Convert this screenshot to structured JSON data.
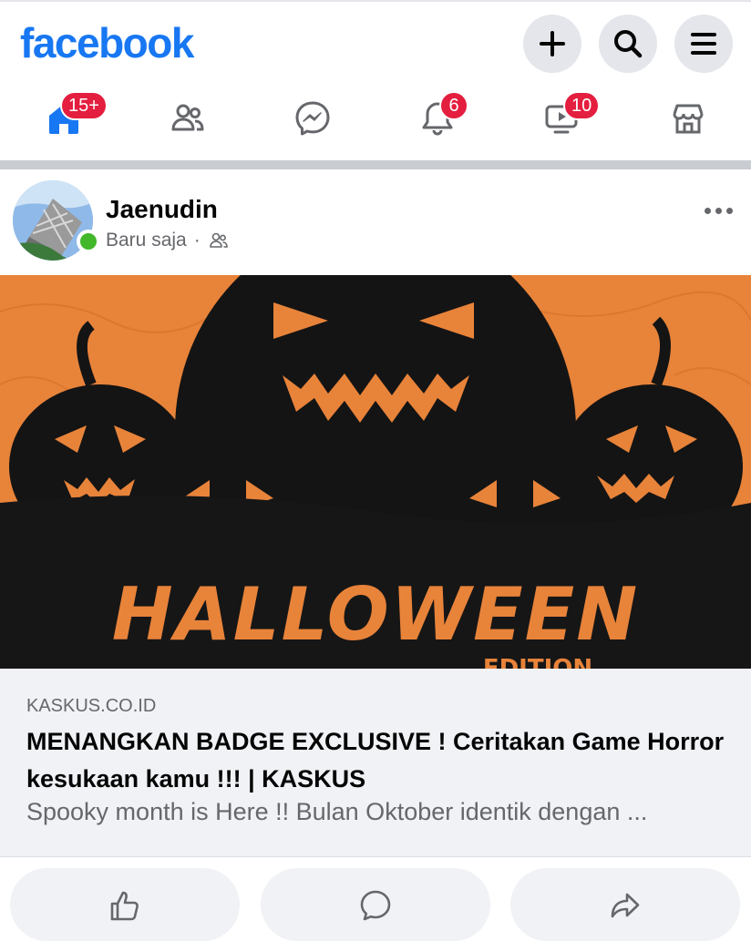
{
  "header": {
    "logo": "facebook",
    "create_icon": "plus-icon",
    "search_icon": "search-icon",
    "menu_icon": "hamburger-menu-icon"
  },
  "nav": {
    "items": [
      {
        "name": "home",
        "icon": "home-icon",
        "badge": "15+"
      },
      {
        "name": "friends",
        "icon": "friends-icon",
        "badge": ""
      },
      {
        "name": "messenger",
        "icon": "messenger-icon",
        "badge": ""
      },
      {
        "name": "notifications",
        "icon": "bell-icon",
        "badge": "6"
      },
      {
        "name": "watch",
        "icon": "video-icon",
        "badge": "10"
      },
      {
        "name": "marketplace",
        "icon": "store-icon",
        "badge": ""
      }
    ]
  },
  "post": {
    "author": "Jaenudin",
    "time": "Baru saja",
    "separator": "·",
    "audience_icon": "friends-audience-icon",
    "online": true,
    "image_alt": "Halloween jack-o'-lantern artwork",
    "image_text": "HALLOWEEN",
    "image_subtext": "EDITION"
  },
  "link_card": {
    "domain": "KASKUS.CO.ID",
    "title": "MENANGKAN BADGE EXCLUSIVE ! Ceritakan Game Horror kesukaan kamu !!! | KASKUS",
    "description": "Spooky month is Here !! Bulan Oktober identik dengan ..."
  },
  "actions": {
    "like_icon": "thumbs-up-icon",
    "comment_icon": "comment-icon",
    "share_icon": "share-icon"
  },
  "colors": {
    "brand": "#1877f2",
    "badge": "#e41e3f",
    "online": "#42b72a",
    "halloween_orange": "#e8833a"
  }
}
